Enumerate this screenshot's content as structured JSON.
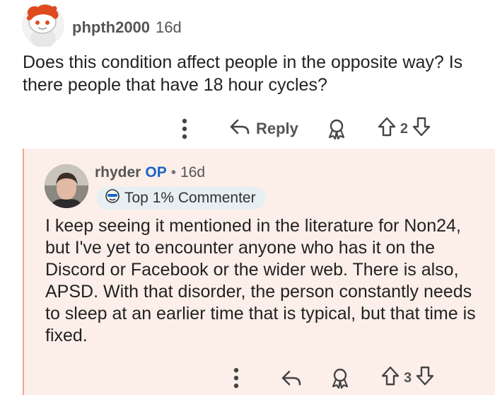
{
  "comment": {
    "author": "phpth2000",
    "age": "16d",
    "body": "Does this condition affect people in the opposite way? Is there people that have 18 hour cycles?",
    "reply_label": "Reply",
    "votes": "2"
  },
  "reply": {
    "author": "rhyder",
    "op_tag": "OP",
    "separator": "•",
    "age": "16d",
    "badge": "Top 1% Commenter",
    "body": "I keep seeing it mentioned in the literature for Non24, but I've yet to encounter anyone who has it on the Discord or Facebook or the wider web. There is also, APSD. With that disorder, the person constantly needs to sleep at an earlier time that is typical, but that time is fixed.",
    "votes": "3"
  },
  "icons": [
    "snoo-avatar-icon",
    "more-options-icon",
    "reply-arrow-icon",
    "award-icon",
    "upvote-icon",
    "downvote-icon",
    "badge-icon"
  ],
  "colors": {
    "op": "#1b64c5",
    "thread_bg": "#fcefe9",
    "thread_line": "#f0a58a",
    "badge_bg": "#e7eff2"
  }
}
